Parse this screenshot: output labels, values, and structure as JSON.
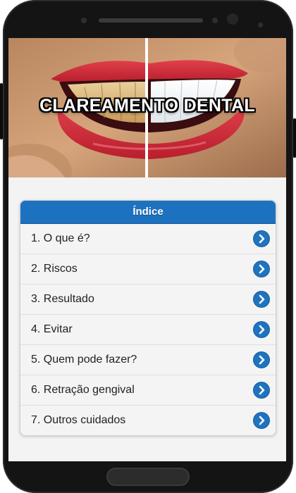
{
  "hero": {
    "title": "CLAREAMENTO DENTAL"
  },
  "index": {
    "header": "Índice",
    "items": [
      {
        "label": "1. O que é?",
        "icon": "chevron-right-icon"
      },
      {
        "label": "2. Riscos",
        "icon": "chevron-right-icon"
      },
      {
        "label": "3. Resultado",
        "icon": "chevron-right-icon"
      },
      {
        "label": "4. Evitar",
        "icon": "chevron-right-icon"
      },
      {
        "label": "5. Quem pode fazer?",
        "icon": "chevron-right-icon"
      },
      {
        "label": "6. Retração gengival",
        "icon": "chevron-right-icon"
      },
      {
        "label": "7. Outros cuidados",
        "icon": "chevron-right-icon"
      }
    ]
  },
  "colors": {
    "accent": "#1d72bf",
    "background": "#f3f3f3",
    "phone_frame": "#141414"
  }
}
